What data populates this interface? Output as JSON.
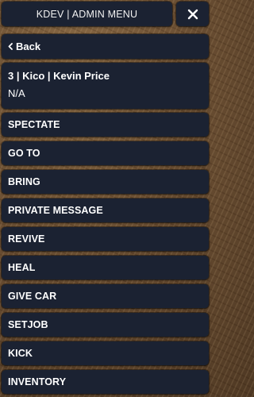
{
  "header": {
    "title": "KDEV | ADMIN MENU"
  },
  "nav": {
    "back_label": "Back"
  },
  "player": {
    "name": "3 | Kico | Kevin Price",
    "job": "N/A"
  },
  "actions": [
    "SPECTATE",
    "GO TO",
    "BRING",
    "PRIVATE MESSAGE",
    "REVIVE",
    "HEAL",
    "GIVE CAR",
    "SETJOB",
    "KICK",
    "INVENTORY"
  ],
  "icons": {
    "close": "close-icon",
    "back": "chevron-left-icon"
  },
  "colors": {
    "panel": "#1b2232",
    "text": "#ffffff"
  }
}
